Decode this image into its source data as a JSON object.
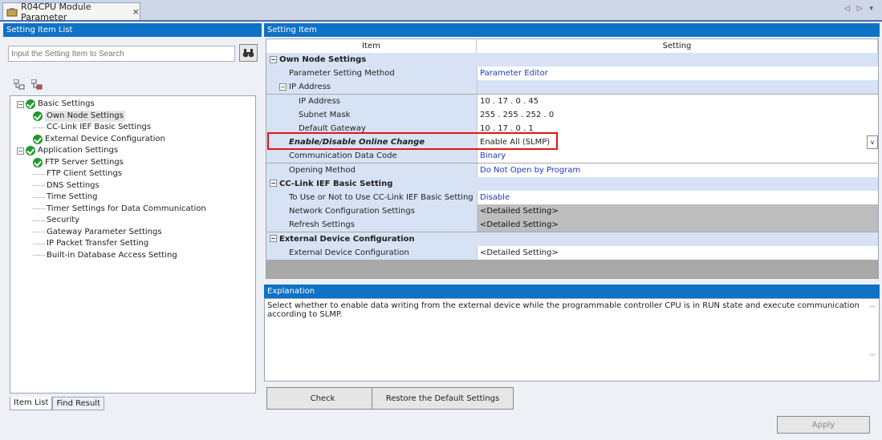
{
  "tab": {
    "title": "R04CPU Module Parameter",
    "close": "×"
  },
  "scroll_arrows": "◁ ▷ ▾",
  "left": {
    "header": "Setting Item List",
    "search_placeholder": "Input the Setting Item to Search",
    "tree": [
      {
        "label": "Basic Settings",
        "level": 0,
        "exp": "⊟",
        "check": true
      },
      {
        "label": "Own Node Settings",
        "level": 1,
        "check": true,
        "selected": true
      },
      {
        "label": "CC-Link IEF Basic Settings",
        "level": 1,
        "check": false
      },
      {
        "label": "External Device Configuration",
        "level": 1,
        "check": true
      },
      {
        "label": "Application Settings",
        "level": 0,
        "exp": "⊟",
        "check": true
      },
      {
        "label": "FTP Server Settings",
        "level": 1,
        "check": true
      },
      {
        "label": "FTP Client Settings",
        "level": 1,
        "check": false
      },
      {
        "label": "DNS Settings",
        "level": 1,
        "check": false
      },
      {
        "label": "Time Setting",
        "level": 1,
        "check": false
      },
      {
        "label": "Timer Settings for Data Communication",
        "level": 1,
        "check": false
      },
      {
        "label": "Security",
        "level": 1,
        "check": false
      },
      {
        "label": "Gateway Parameter Settings",
        "level": 1,
        "check": false
      },
      {
        "label": "IP Packet Transfer Setting",
        "level": 1,
        "check": false
      },
      {
        "label": "Built-in Database Access Setting",
        "level": 1,
        "check": false
      }
    ],
    "tabs": [
      "Item List",
      "Find Result"
    ]
  },
  "right": {
    "header": "Setting Item",
    "col_item": "Item",
    "col_setting": "Setting",
    "rows": [
      {
        "type": "cat",
        "item": "Own Node Settings",
        "setting": ""
      },
      {
        "type": "it",
        "item": "Parameter Setting Method",
        "setting": "Parameter Editor",
        "style": "blue",
        "indent": 1
      },
      {
        "type": "sub",
        "item": "IP Address",
        "setting": "",
        "indent": 1
      },
      {
        "type": "it",
        "item": "IP Address",
        "setting": "10 . 17 . 0 . 45",
        "style": "",
        "indent": 2
      },
      {
        "type": "it",
        "item": "Subnet Mask",
        "setting": "255 . 255 . 252 . 0",
        "style": "",
        "indent": 2
      },
      {
        "type": "it",
        "item": "Default Gateway",
        "setting": "10 . 17 . 0 . 1",
        "style": "",
        "indent": 2
      },
      {
        "type": "it",
        "item": "Enable/Disable Online Change",
        "setting": "Enable All (SLMP)",
        "style": "",
        "indent": 1,
        "bold": true,
        "dropdown": true
      },
      {
        "type": "it",
        "item": "Communication Data Code",
        "setting": "Binary",
        "style": "blue",
        "indent": 1
      },
      {
        "type": "it",
        "item": "Opening Method",
        "setting": "Do Not Open by Program",
        "style": "blue",
        "indent": 1
      },
      {
        "type": "cat",
        "item": "CC-Link IEF Basic Setting",
        "setting": ""
      },
      {
        "type": "it",
        "item": "To Use or Not to Use CC-Link IEF Basic Setting",
        "setting": "Disable",
        "style": "blue",
        "indent": 1
      },
      {
        "type": "it",
        "item": "Network Configuration Settings",
        "setting": "<Detailed Setting>",
        "style": "gray",
        "indent": 1
      },
      {
        "type": "it",
        "item": "Refresh Settings",
        "setting": "<Detailed Setting>",
        "style": "gray",
        "indent": 1
      },
      {
        "type": "cat",
        "item": "External Device Configuration",
        "setting": ""
      },
      {
        "type": "it",
        "item": "External Device Configuration",
        "setting": "<Detailed Setting>",
        "style": "",
        "indent": 1
      }
    ],
    "explanation_header": "Explanation",
    "explanation": "Select whether to enable data writing from the external device while the programmable controller CPU is in RUN state and execute communication according to SLMP.",
    "check_btn": "Check",
    "restore_btn": "Restore the Default Settings",
    "apply_btn": "Apply"
  }
}
